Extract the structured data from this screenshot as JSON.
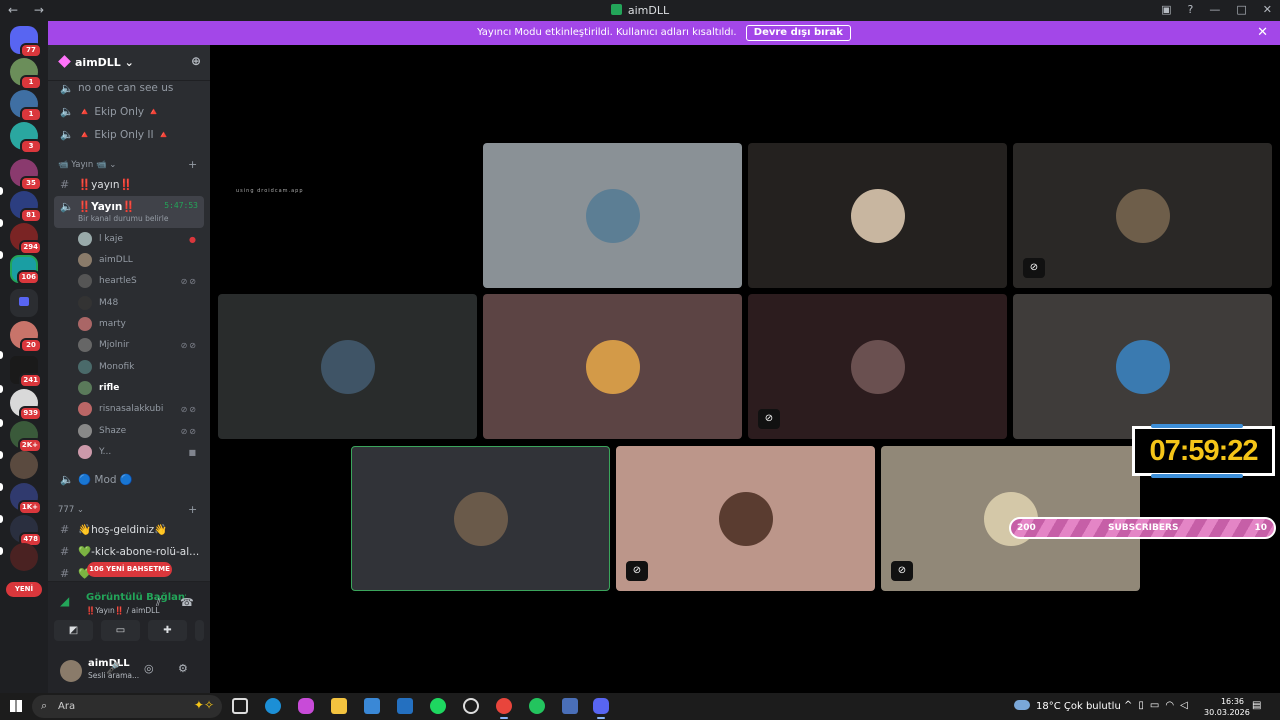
{
  "window": {
    "title": "aimDLL"
  },
  "banner": {
    "text": "Yayıncı Modu etkinleştirildi. Kullanıcı adları kısaltıldı.",
    "button": "Devre dışı bırak"
  },
  "servers": {
    "badges": [
      "77",
      "1",
      "1",
      "3",
      "35",
      "81",
      "294",
      "106",
      "20",
      "241",
      "939",
      "2K+",
      "1K+",
      "478"
    ],
    "new_label": "YENİ"
  },
  "guild": {
    "name": "aimDLL"
  },
  "channels": {
    "top": [
      "no one can see us",
      "🔺 Ekip Only 🔺",
      "🔺 Ekip Only II 🔺"
    ],
    "cat1": "📹 Yayın 📹",
    "yayin_text": "‼️yayın‼️",
    "voice_active": {
      "name": "‼️Yayın‼️",
      "timer": "5:47:53",
      "status": "Bir kanal durumu belirle"
    },
    "users": [
      "l kaje",
      "aimDLL",
      "heartleS",
      "M48",
      "marty",
      "Mjolnir",
      "Monofik",
      "rifle",
      "risnasalakkubi",
      "Shaze",
      "Y..."
    ],
    "mod": "🔵 Mod 🔵",
    "cat2": "777",
    "text_channels": [
      "👋hoş-geldiniz👋",
      "💚-kick-abone-rolü-al...",
      "💚-leaderboard"
    ],
    "mention_badge": "106 YENİ BAHSETME"
  },
  "voice_panel": {
    "title": "Görüntülü Bağlantı Kuruldu",
    "subtitle": "‼️Yayın‼️ / aimDLL"
  },
  "user_panel": {
    "name": "aimDLL",
    "status": "Sesli arama..."
  },
  "stage": {
    "droidcam": "using droidcam.app",
    "timer": "07:59:22",
    "subs_left": "200",
    "subs_label": "SUBSCRIBERS",
    "subs_right": "10"
  },
  "taskbar": {
    "search_placeholder": "Ara",
    "weather": "18°C  Çok bulutlu",
    "time": "16:36",
    "date": "30.03.2026"
  },
  "colors": {
    "banner": "#a347e8",
    "accent_green": "#23a559",
    "badge_red": "#da373c"
  }
}
